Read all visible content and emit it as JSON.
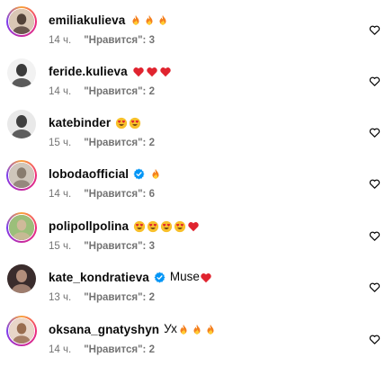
{
  "comments": [
    {
      "username": "emiliakulieva",
      "text": "",
      "emojis": [
        "fire-emoji",
        "fire-emoji",
        "fire-emoji"
      ],
      "time": "14 ч.",
      "likes": "\"Нравится\": 3",
      "verified": false,
      "story_ring": true,
      "avatar_colors": [
        "#d9c7b4",
        "#3a2a22"
      ]
    },
    {
      "username": "feride.kulieva",
      "text": "",
      "emojis": [
        "red-heart-emoji",
        "red-heart-emoji",
        "red-heart-emoji"
      ],
      "time": "14 ч.",
      "likes": "\"Нравится\": 2",
      "verified": false,
      "story_ring": false,
      "avatar_colors": [
        "#f2f2f2",
        "#1b1b1b"
      ]
    },
    {
      "username": "katebinder",
      "text": "",
      "emojis": [
        "heart-eyes-emoji",
        "heart-eyes-emoji"
      ],
      "time": "15 ч.",
      "likes": "\"Нравится\": 2",
      "verified": false,
      "story_ring": false,
      "avatar_colors": [
        "#e9e9e9",
        "#222222"
      ]
    },
    {
      "username": "lobodaofficial",
      "text": "",
      "emojis": [
        "fire-emoji"
      ],
      "time": "14 ч.",
      "likes": "\"Нравится\": 6",
      "verified": true,
      "story_ring": true,
      "avatar_colors": [
        "#cfc6bb",
        "#7c6e62"
      ]
    },
    {
      "username": "polipollpolina",
      "text": "",
      "emojis": [
        "heart-eyes-emoji",
        "heart-eyes-emoji",
        "heart-eyes-emoji",
        "heart-eyes-emoji",
        "red-heart-emoji"
      ],
      "time": "15 ч.",
      "likes": "\"Нравится\": 3",
      "verified": false,
      "story_ring": true,
      "avatar_colors": [
        "#9bbf7a",
        "#d8b8a0"
      ]
    },
    {
      "username": "kate_kondratieva",
      "text": "Muse",
      "emojis_after_text": [
        "red-heart-emoji"
      ],
      "emojis": [],
      "time": "13 ч.",
      "likes": "\"Нравится\": 2",
      "verified": true,
      "story_ring": false,
      "avatar_colors": [
        "#3a2c2c",
        "#c9a08a"
      ]
    },
    {
      "username": "oksana_gnatyshyn",
      "text": "Ух",
      "emojis_after_text": [
        "fire-emoji",
        "fire-emoji",
        "fire-emoji"
      ],
      "emojis": [],
      "time": "14 ч.",
      "likes": "\"Нравится\": 2",
      "verified": false,
      "story_ring": true,
      "avatar_colors": [
        "#e8d6c8",
        "#8a5a3a"
      ]
    }
  ],
  "icons": {
    "like": "heart-outline-icon",
    "verified": "verified-badge-icon"
  },
  "colors": {
    "text": "#0a0a0a",
    "meta": "#737373",
    "verified": "#0095f6",
    "heart": "#e0242f"
  }
}
